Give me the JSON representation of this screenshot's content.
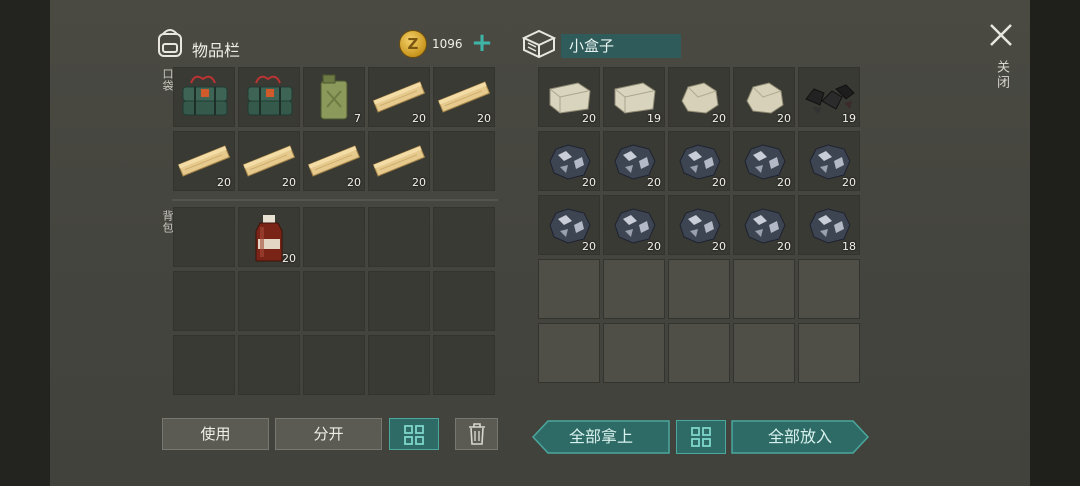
{
  "inventory": {
    "title": "物品栏",
    "coins": "1096",
    "pocket_label": "口袋",
    "backpack_label": "背包",
    "pocket_slots": [
      {
        "item": "rope-bundle-icon",
        "qty": ""
      },
      {
        "item": "rope-bundle-icon",
        "qty": ""
      },
      {
        "item": "jerrycan-icon",
        "qty": "7"
      },
      {
        "item": "wood-plank-icon",
        "qty": "20"
      },
      {
        "item": "wood-plank-icon",
        "qty": "20"
      },
      {
        "item": "wood-plank-icon",
        "qty": "20"
      },
      {
        "item": "wood-plank-icon",
        "qty": "20"
      },
      {
        "item": "wood-plank-icon",
        "qty": "20"
      },
      {
        "item": "wood-plank-icon",
        "qty": "20"
      },
      {
        "item": "",
        "qty": ""
      }
    ],
    "backpack_slots": [
      {
        "item": "",
        "qty": ""
      },
      {
        "item": "medicine-bottle-icon",
        "qty": "20"
      },
      {
        "item": "",
        "qty": ""
      },
      {
        "item": "",
        "qty": ""
      },
      {
        "item": "",
        "qty": ""
      },
      {
        "item": "",
        "qty": ""
      },
      {
        "item": "",
        "qty": ""
      },
      {
        "item": "",
        "qty": ""
      },
      {
        "item": "",
        "qty": ""
      },
      {
        "item": "",
        "qty": ""
      },
      {
        "item": "",
        "qty": ""
      },
      {
        "item": "",
        "qty": ""
      },
      {
        "item": "",
        "qty": ""
      },
      {
        "item": "",
        "qty": ""
      },
      {
        "item": "",
        "qty": ""
      }
    ]
  },
  "container": {
    "name": "小盒子",
    "slots": [
      {
        "item": "limestone-block-icon",
        "qty": "20"
      },
      {
        "item": "limestone-block-icon",
        "qty": "19"
      },
      {
        "item": "stone-icon",
        "qty": "20"
      },
      {
        "item": "stone-icon",
        "qty": "20"
      },
      {
        "item": "coal-icon",
        "qty": "19"
      },
      {
        "item": "iron-ore-icon",
        "qty": "20"
      },
      {
        "item": "iron-ore-icon",
        "qty": "20"
      },
      {
        "item": "iron-ore-icon",
        "qty": "20"
      },
      {
        "item": "iron-ore-icon",
        "qty": "20"
      },
      {
        "item": "iron-ore-icon",
        "qty": "20"
      },
      {
        "item": "iron-ore-icon",
        "qty": "20"
      },
      {
        "item": "iron-ore-icon",
        "qty": "20"
      },
      {
        "item": "iron-ore-icon",
        "qty": "20"
      },
      {
        "item": "iron-ore-icon",
        "qty": "20"
      },
      {
        "item": "iron-ore-icon",
        "qty": "18"
      }
    ]
  },
  "close_label": "关闭",
  "buttons": {
    "use": "使用",
    "split": "分开",
    "take_all": "全部拿上",
    "put_all": "全部放入"
  },
  "colors": {
    "accent": "#3fb5a8",
    "teal_button": "#2f6b66"
  }
}
